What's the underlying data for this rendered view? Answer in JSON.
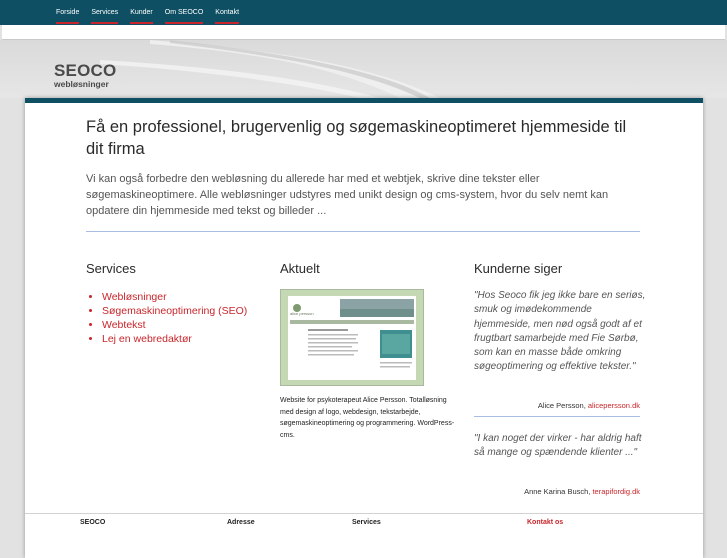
{
  "nav": {
    "items": [
      "Forside",
      "Services",
      "Kunder",
      "Om SEOCO",
      "Kontakt"
    ]
  },
  "brand": {
    "name": "SEOCO",
    "tagline": "webløsninger"
  },
  "main": {
    "headline": "Få en professionel, brugervenlig og søgemaskineoptimeret hjemmeside til dit firma",
    "intro": "Vi kan også forbedre den webløsning du allerede har med et webtjek, skrive dine tekster eller søgemaskineoptimere. Alle webløsninger udstyres med unikt design og cms-system, hvor du selv nemt kan opdatere din hjemmeside med tekst og billeder ..."
  },
  "services": {
    "title": "Services",
    "items": [
      "Webløsninger",
      "Søgemaskineoptimering (SEO)",
      "Webtekst",
      "Lej en webredaktør"
    ]
  },
  "news": {
    "title": "Aktuelt",
    "thumbnail_label": "alice persson",
    "caption": "Website for psykoterapeut Alice Persson. Totalløsning med design af logo, webdesign, tekstarbejde, søgemaskineoptimering og programmering. WordPress-cms."
  },
  "testimonials": {
    "title": "Kunderne siger",
    "items": [
      {
        "quote": "\"Hos Seoco fik jeg ikke bare en seriøs, smuk og imødekommende hjemmeside, men nød også godt af et frugtbart samarbejde med Fie Sørbø, som kan en masse både omkring søgeoptimering og effektive tekster.\"",
        "author": "Alice Persson,",
        "link": "alicepersson.dk"
      },
      {
        "quote": "\"I kan noget der virker - har aldrig haft så mange og spændende klienter ...\"",
        "author": "Anne Karina Busch,",
        "link": "terapifordig.dk"
      }
    ]
  },
  "footer": {
    "col1": "SEOCO",
    "col2": "Adresse",
    "col3": "Services",
    "col4": "Kontakt os"
  },
  "colors": {
    "nav_bg": "#0e4f63",
    "accent_red": "#c8262b",
    "rule_blue": "#a7bde2"
  }
}
